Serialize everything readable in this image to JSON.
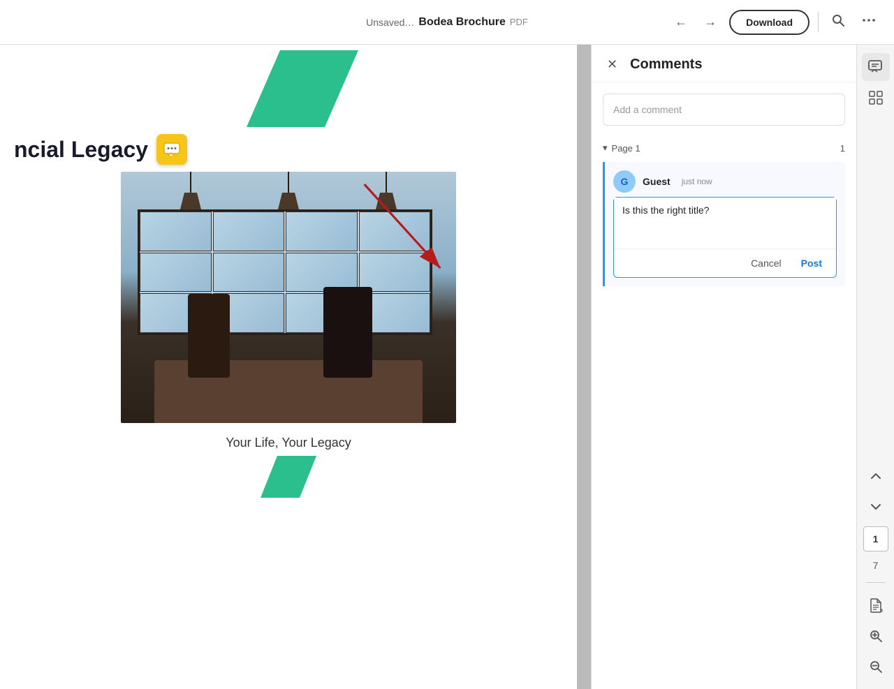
{
  "topbar": {
    "unsaved_label": "Unsaved…",
    "doc_title": "Bodea Brochure",
    "doc_type": "PDF",
    "download_label": "Download",
    "back_icon": "←",
    "forward_icon": "→",
    "search_icon": "🔍",
    "more_icon": "⋯"
  },
  "brochure": {
    "title": "ncial Legacy",
    "subtitle": "Your Life, Your Legacy",
    "comment_icon": "💬"
  },
  "comments": {
    "panel_title": "Comments",
    "close_icon": "✕",
    "add_placeholder": "Add a comment",
    "page_label": "Page 1",
    "page_count": "1",
    "chevron_down": "▾",
    "author_name": "Guest",
    "timestamp": "just now",
    "comment_text": "Is this the right title?",
    "cancel_label": "Cancel",
    "post_label": "Post",
    "guest_initial": "G"
  },
  "right_sidebar": {
    "comment_icon": "💬",
    "grid_icon": "⊞",
    "chevron_up": "⌃",
    "chevron_down": "⌄",
    "page_current": "1",
    "page_total": "7",
    "doc_icon": "📄",
    "zoom_in_icon": "+",
    "zoom_out_icon": "−"
  }
}
